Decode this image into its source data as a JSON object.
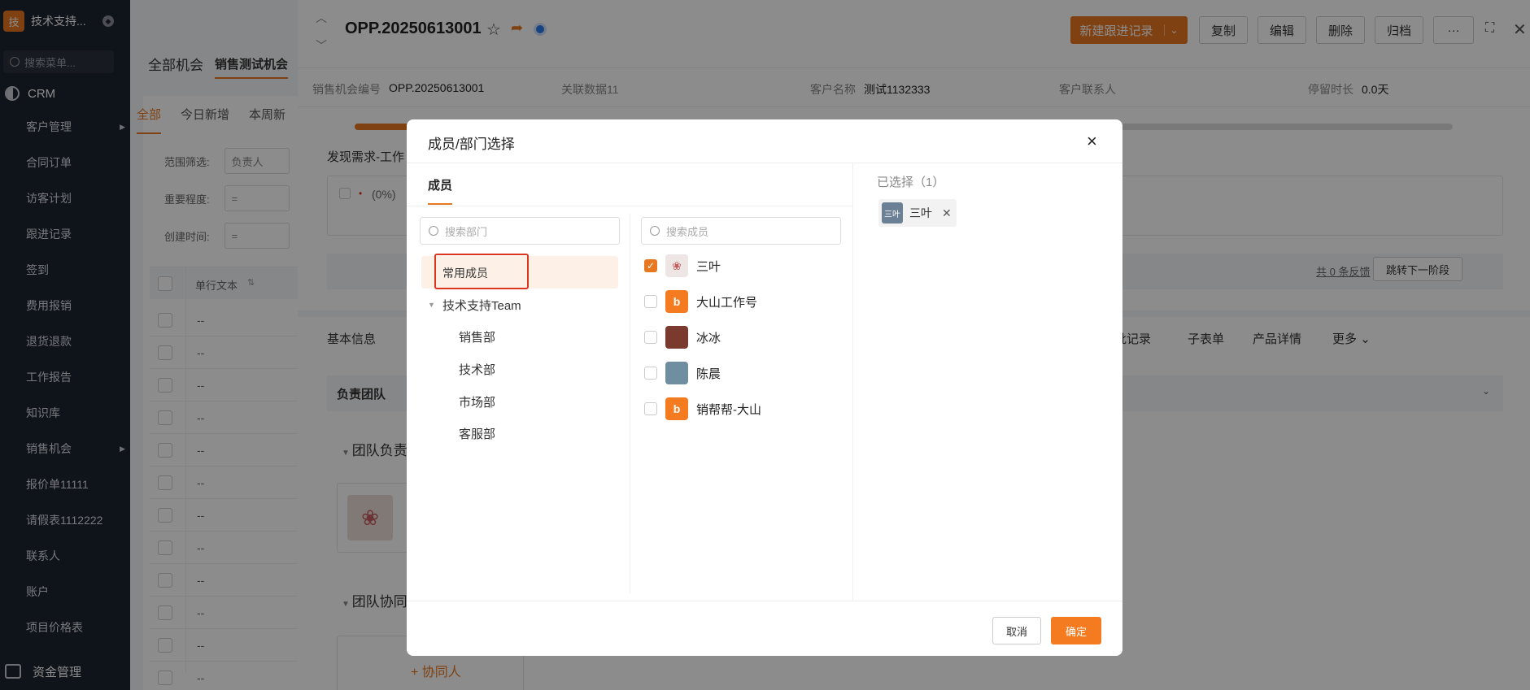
{
  "sidebar": {
    "logo_char": "技",
    "org_name": "技术支持...",
    "search_placeholder": "搜索菜单...",
    "module": "CRM",
    "items": [
      {
        "label": "客户管理",
        "has_arrow": true
      },
      {
        "label": "合同订单"
      },
      {
        "label": "访客计划"
      },
      {
        "label": "跟进记录"
      },
      {
        "label": "签到"
      },
      {
        "label": "费用报销"
      },
      {
        "label": "退货退款"
      },
      {
        "label": "工作报告"
      },
      {
        "label": "知识库"
      },
      {
        "label": "销售机会",
        "has_arrow": true
      },
      {
        "label": "报价单11111"
      },
      {
        "label": "请假表1112222"
      },
      {
        "label": "联系人"
      },
      {
        "label": "账户"
      },
      {
        "label": "项目价格表"
      }
    ],
    "bottom": "资金管理"
  },
  "list": {
    "tabs": [
      "全部机会",
      "销售测试机会"
    ],
    "subtabs": [
      "全部",
      "今日新增",
      "本周新"
    ],
    "filters": [
      {
        "label": "范围筛选:",
        "value": "负责人"
      },
      {
        "label": "重要程度:",
        "value": "="
      },
      {
        "label": "创建时间:",
        "value": "="
      }
    ],
    "column": "单行文本",
    "rows": [
      "--",
      "--",
      "--",
      "--",
      "--",
      "--",
      "--",
      "--",
      "--",
      "--",
      "--",
      "--"
    ]
  },
  "detail": {
    "title": "OPP.20250613001",
    "buttons": {
      "new_follow": "新建跟进记录",
      "copy": "复制",
      "edit": "编辑",
      "delete": "删除",
      "archive": "归档",
      "more": "···"
    },
    "info": [
      {
        "label": "销售机会编号",
        "value": "OPP.20250613001"
      },
      {
        "label": "关联数据11",
        "value": ""
      },
      {
        "label": "客户名称",
        "value": "测试1132333"
      },
      {
        "label": "客户联系人",
        "value": ""
      },
      {
        "label": "停留时长",
        "value": "0.0天"
      }
    ],
    "stage_label": "发现需求-工作",
    "stage_percent": "(0%)",
    "feedback_link": "共 0 条反馈",
    "next_stage": "跳转下一阶段",
    "tabs": [
      "基本信息",
      "批记录",
      "子表单",
      "产品详情",
      "更多"
    ],
    "team_title": "负责团队",
    "team_owner": "团队负责",
    "team_assist": "团队协同",
    "add_assist": "+ 协同人"
  },
  "modal": {
    "title": "成员/部门选择",
    "close": "×",
    "tab": "成员",
    "dept_search_placeholder": "搜索部门",
    "member_search_placeholder": "搜索成员",
    "common": "常用成员",
    "team": "技术支持Team",
    "departments": [
      "销售部",
      "技术部",
      "市场部",
      "客服部"
    ],
    "members": [
      {
        "name": "三叶",
        "checked": true,
        "avatar": "rose"
      },
      {
        "name": "大山工作号",
        "checked": false,
        "avatar": "b"
      },
      {
        "name": "冰冰",
        "checked": false,
        "avatar": "ice"
      },
      {
        "name": "陈晨",
        "checked": false,
        "avatar": "chen"
      },
      {
        "name": "销帮帮-大山",
        "checked": false,
        "avatar": "b"
      }
    ],
    "selected_title": "已选择（1）",
    "selected": [
      {
        "avatar_text": "三叶",
        "name": "三叶"
      }
    ],
    "cancel": "取消",
    "ok": "确定"
  },
  "colors": {
    "accent": "#e87722",
    "sidebar_bg": "#1d2330",
    "highlight_border": "#d9361e"
  }
}
